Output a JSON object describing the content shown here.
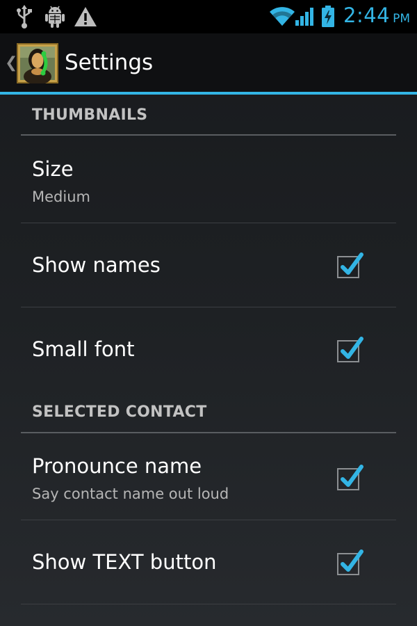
{
  "status_bar": {
    "icons_left": [
      "usb-icon",
      "android-debug-icon",
      "warning-icon"
    ],
    "icons_right": [
      "wifi-icon",
      "signal-icon",
      "battery-charging-icon"
    ],
    "time": "2:44",
    "ampm": "PM"
  },
  "action_bar": {
    "up_icon": "chevron-left-icon",
    "app_icon": "mona-lisa-phone-icon",
    "title": "Settings"
  },
  "settings": {
    "thumbnails_header": "THUMBNAILS",
    "size": {
      "title": "Size",
      "summary": "Medium"
    },
    "show_names": {
      "title": "Show names",
      "checked": true
    },
    "small_font": {
      "title": "Small font",
      "checked": true
    },
    "selected_contact_header": "SELECTED CONTACT",
    "pronounce_name": {
      "title": "Pronounce name",
      "summary": "Say contact name out loud",
      "checked": true
    },
    "show_text_button": {
      "title": "Show TEXT button",
      "checked": true
    }
  },
  "colors": {
    "accent": "#33b5e5",
    "background": "#1e2124",
    "text_primary": "#ffffff",
    "text_secondary": "#b6b6b6"
  }
}
